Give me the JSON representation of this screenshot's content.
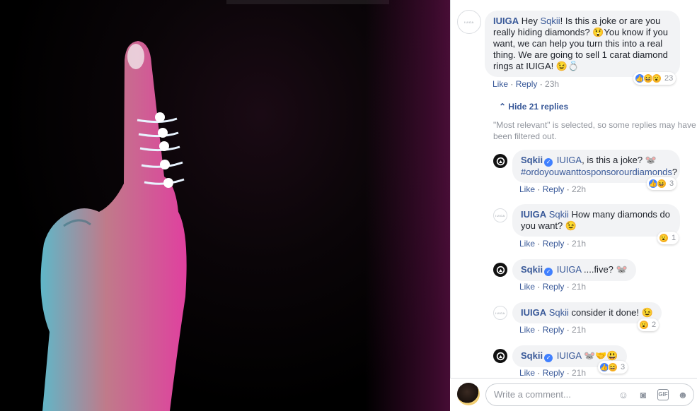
{
  "comments": {
    "main": {
      "author": "IUIGA",
      "avatar_text": "IUIGA",
      "text_before": "Hey ",
      "mention": "Sqkii",
      "text_after": "! Is this a joke or are you really hiding diamonds? 😲You know if you want, we can help you turn this into a real thing. We are going to sell 1 carat diamond rings at IUIGA! 😉💍",
      "like": "Like",
      "reply": "Reply",
      "time": "23h",
      "reaction_count": "23"
    },
    "hide_replies": "Hide 21 replies",
    "filter_note": "\"Most relevant\" is selected, so some replies may have been filtered out.",
    "replies": [
      {
        "author": "Sqkii",
        "verified": "✓",
        "mention": "IUIGA",
        "text": ", is this a joke? 🐭",
        "hashtag": "#ordoyouwanttosponsorourdiamonds",
        "tail": "?",
        "time": "22h",
        "reaction_count": "3"
      },
      {
        "author": "IUIGA",
        "mention": "Sqkii",
        "text": " How many diamonds do you want? 😉",
        "time": "21h",
        "reaction_count": "1"
      },
      {
        "author": "Sqkii",
        "verified": "✓",
        "mention": "IUIGA",
        "text": " ....five? 🐭",
        "time": "21h"
      },
      {
        "author": "IUIGA",
        "mention": "Sqkii",
        "text": " consider it done! 😉",
        "time": "21h",
        "reaction_count": "2"
      },
      {
        "author": "Sqkii",
        "verified": "✓",
        "mention": "IUIGA",
        "text": " 🐭🤝😃",
        "time": "21h",
        "reaction_count": "3"
      }
    ],
    "separator": " · ",
    "like": "Like",
    "reply": "Reply"
  },
  "composer": {
    "placeholder": "Write a comment...",
    "icons": [
      "emoji-icon",
      "camera-icon",
      "gif-icon",
      "sticker-icon"
    ]
  },
  "colors": {
    "link": "#385898",
    "bubble": "#f2f3f5",
    "like": "#4080ff"
  }
}
